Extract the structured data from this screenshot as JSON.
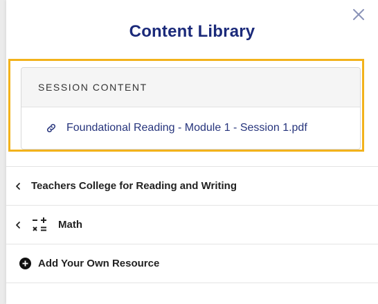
{
  "panel": {
    "title": "Content Library",
    "close_icon": "close-icon"
  },
  "session": {
    "header": "SESSION CONTENT",
    "file_icon": "link-icon",
    "file_name": "Foundational Reading - Module 1 - Session 1.pdf"
  },
  "sections": [
    {
      "label": "Teachers College for Reading and Writing",
      "icon": "chevron-left-icon"
    },
    {
      "label": "Math",
      "icon": "math-operations-icon"
    },
    {
      "label": "Add Your Own Resource",
      "icon": "plus-circle-icon"
    }
  ],
  "colors": {
    "title": "#1b2a7a",
    "link": "#26347c",
    "highlight": "#f2b21b"
  }
}
